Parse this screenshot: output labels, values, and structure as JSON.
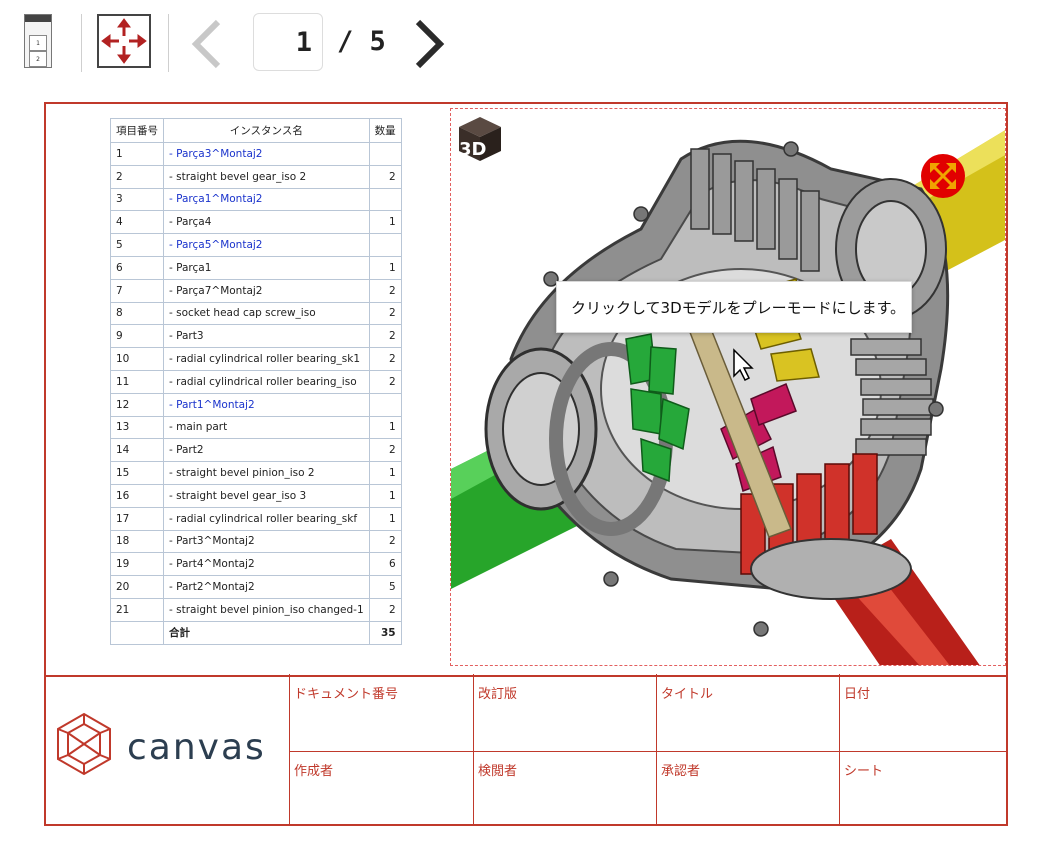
{
  "toolbar": {
    "thumb_pages": [
      "1",
      "2"
    ],
    "page_current": "1",
    "page_total_text": "/ 5"
  },
  "bom": {
    "headers": [
      "項目番号",
      "インスタンス名",
      "数量"
    ],
    "rows": [
      {
        "no": "1",
        "name": "- Parça3^Montaj2",
        "qty": "",
        "assembly": true
      },
      {
        "no": "2",
        "name": "- straight bevel gear_iso 2",
        "qty": "2",
        "assembly": false
      },
      {
        "no": "3",
        "name": "- Parça1^Montaj2",
        "qty": "",
        "assembly": true
      },
      {
        "no": "4",
        "name": "- Parça4",
        "qty": "1",
        "assembly": false
      },
      {
        "no": "5",
        "name": "- Parça5^Montaj2",
        "qty": "",
        "assembly": true
      },
      {
        "no": "6",
        "name": "- Parça1",
        "qty": "1",
        "assembly": false
      },
      {
        "no": "7",
        "name": "- Parça7^Montaj2",
        "qty": "2",
        "assembly": false
      },
      {
        "no": "8",
        "name": "- socket head cap screw_iso",
        "qty": "2",
        "assembly": false
      },
      {
        "no": "9",
        "name": "- Part3",
        "qty": "2",
        "assembly": false
      },
      {
        "no": "10",
        "name": "- radial cylindrical roller bearing_sk1",
        "qty": "2",
        "assembly": false
      },
      {
        "no": "11",
        "name": "- radial cylindrical roller bearing_iso",
        "qty": "2",
        "assembly": false
      },
      {
        "no": "12",
        "name": "- Part1^Montaj2",
        "qty": "",
        "assembly": true
      },
      {
        "no": "13",
        "name": "- main part",
        "qty": "1",
        "assembly": false
      },
      {
        "no": "14",
        "name": "- Part2",
        "qty": "2",
        "assembly": false
      },
      {
        "no": "15",
        "name": "- straight bevel pinion_iso 2",
        "qty": "1",
        "assembly": false
      },
      {
        "no": "16",
        "name": "- straight bevel gear_iso 3",
        "qty": "1",
        "assembly": false
      },
      {
        "no": "17",
        "name": "- radial cylindrical roller bearing_skf",
        "qty": "1",
        "assembly": false
      },
      {
        "no": "18",
        "name": "- Part3^Montaj2",
        "qty": "2",
        "assembly": false
      },
      {
        "no": "19",
        "name": "- Part4^Montaj2",
        "qty": "6",
        "assembly": false
      },
      {
        "no": "20",
        "name": "- Part2^Montaj2",
        "qty": "5",
        "assembly": false
      },
      {
        "no": "21",
        "name": "- straight bevel pinion_iso changed-1",
        "qty": "2",
        "assembly": false
      }
    ],
    "total_label": "合計",
    "total_qty": "35"
  },
  "viewer": {
    "badge_text": "3D",
    "tooltip": "クリックして3Dモデルをプレーモードにします。"
  },
  "title_block": {
    "brand": "canvas",
    "doc_number_label": "ドキュメント番号",
    "revision_label": "改訂版",
    "title_label": "タイトル",
    "date_label": "日付",
    "author_label": "作成者",
    "checker_label": "検閲者",
    "approver_label": "承認者",
    "sheet_label": "シート"
  },
  "colors": {
    "frame": "#c0392b",
    "link_blue": "#1a33cc",
    "brand_text": "#2c3e50",
    "expand_red": "#e10000"
  }
}
